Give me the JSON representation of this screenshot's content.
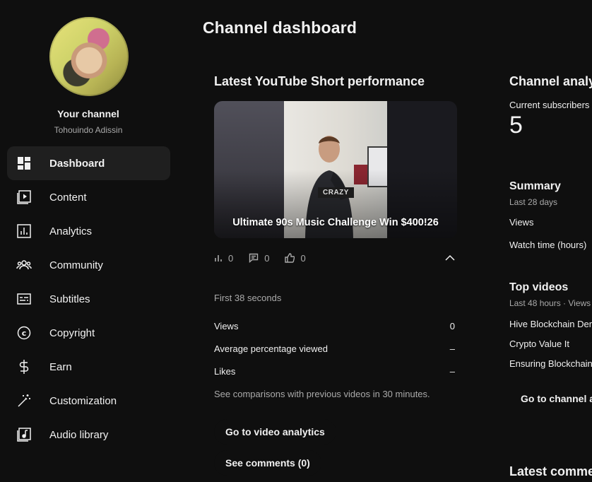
{
  "sidebar": {
    "channel_title": "Your channel",
    "channel_handle": "Tohouindo Adissin",
    "items": [
      {
        "label": "Dashboard",
        "icon": "dashboard-icon",
        "active": true
      },
      {
        "label": "Content",
        "icon": "content-icon"
      },
      {
        "label": "Analytics",
        "icon": "analytics-icon"
      },
      {
        "label": "Community",
        "icon": "community-icon"
      },
      {
        "label": "Subtitles",
        "icon": "subtitles-icon"
      },
      {
        "label": "Copyright",
        "icon": "copyright-icon"
      },
      {
        "label": "Earn",
        "icon": "earn-icon"
      },
      {
        "label": "Customization",
        "icon": "customization-icon"
      },
      {
        "label": "Audio library",
        "icon": "audio-library-icon"
      }
    ]
  },
  "page": {
    "title": "Channel dashboard"
  },
  "short_card": {
    "title": "Latest YouTube Short performance",
    "thumbnail_caption": "Ultimate 90s Music Challenge Win $400!26",
    "thumbnail_tag": "CRAZY",
    "stats": {
      "views": "0",
      "comments": "0",
      "likes": "0"
    },
    "period": "First 38 seconds",
    "metrics": [
      {
        "label": "Views",
        "value": "0"
      },
      {
        "label": "Average percentage viewed",
        "value": "–"
      },
      {
        "label": "Likes",
        "value": "–"
      }
    ],
    "note": "See comparisons with previous videos in 30 minutes.",
    "analytics_button": "Go to video analytics",
    "comments_button": "See comments (0)"
  },
  "analytics_card": {
    "title": "Channel analytics",
    "subscribers_label": "Current subscribers",
    "subscribers_value": "5",
    "summary_title": "Summary",
    "summary_period": "Last 28 days",
    "summary_rows": [
      "Views",
      "Watch time (hours)"
    ],
    "top_videos_title": "Top videos",
    "top_videos_period": "Last 48 hours · Views",
    "top_videos": [
      "Hive Blockchain Dem",
      "Crypto Value It",
      "Ensuring Blockchain"
    ],
    "analytics_button": "Go to channel an",
    "latest_comments_title": "Latest comments"
  }
}
